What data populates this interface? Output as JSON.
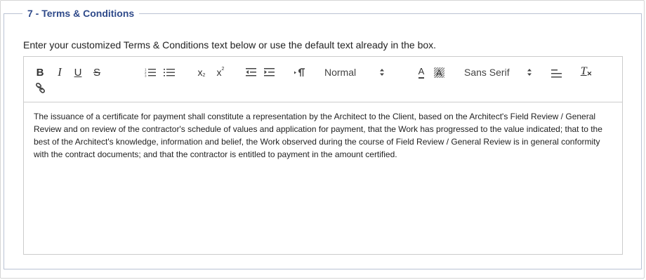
{
  "section": {
    "legend": "7 - Terms & Conditions",
    "intro": "Enter your customized Terms & Conditions text below or use the default text already in the box."
  },
  "toolbar": {
    "bold": "B",
    "italic": "I",
    "underline": "U",
    "strike": "S",
    "subscript": "x",
    "subscript_mark": "2",
    "superscript": "x",
    "superscript_mark": "2",
    "header_value": "Normal",
    "font_value": "Sans Serif",
    "text_color_glyph": "A",
    "background_glyph": "A",
    "clean_glyph": "T"
  },
  "icons": {
    "ordered_list": "ordered-list-icon",
    "bullet_list": "bullet-list-icon",
    "outdent": "outdent-icon",
    "indent": "indent-icon",
    "direction": "text-direction-icon",
    "align": "align-icon",
    "link": "link-icon"
  },
  "editor": {
    "content": "The issuance of a certificate for payment shall constitute a representation by the Architect to the Client, based on the Architect's Field Review / General Review and on review of the contractor's schedule of values and application for payment, that the Work has progressed to the value indicated; that to the best of the Architect's knowledge, information and belief, the Work observed during the course of Field Review / General Review is in general conformity with the contract documents; and that the contractor is entitled to payment in the amount certified."
  },
  "colors": {
    "legend": "#2f4a8a",
    "fieldset_border": "#b9c2d3",
    "editor_border": "#cccccc"
  }
}
